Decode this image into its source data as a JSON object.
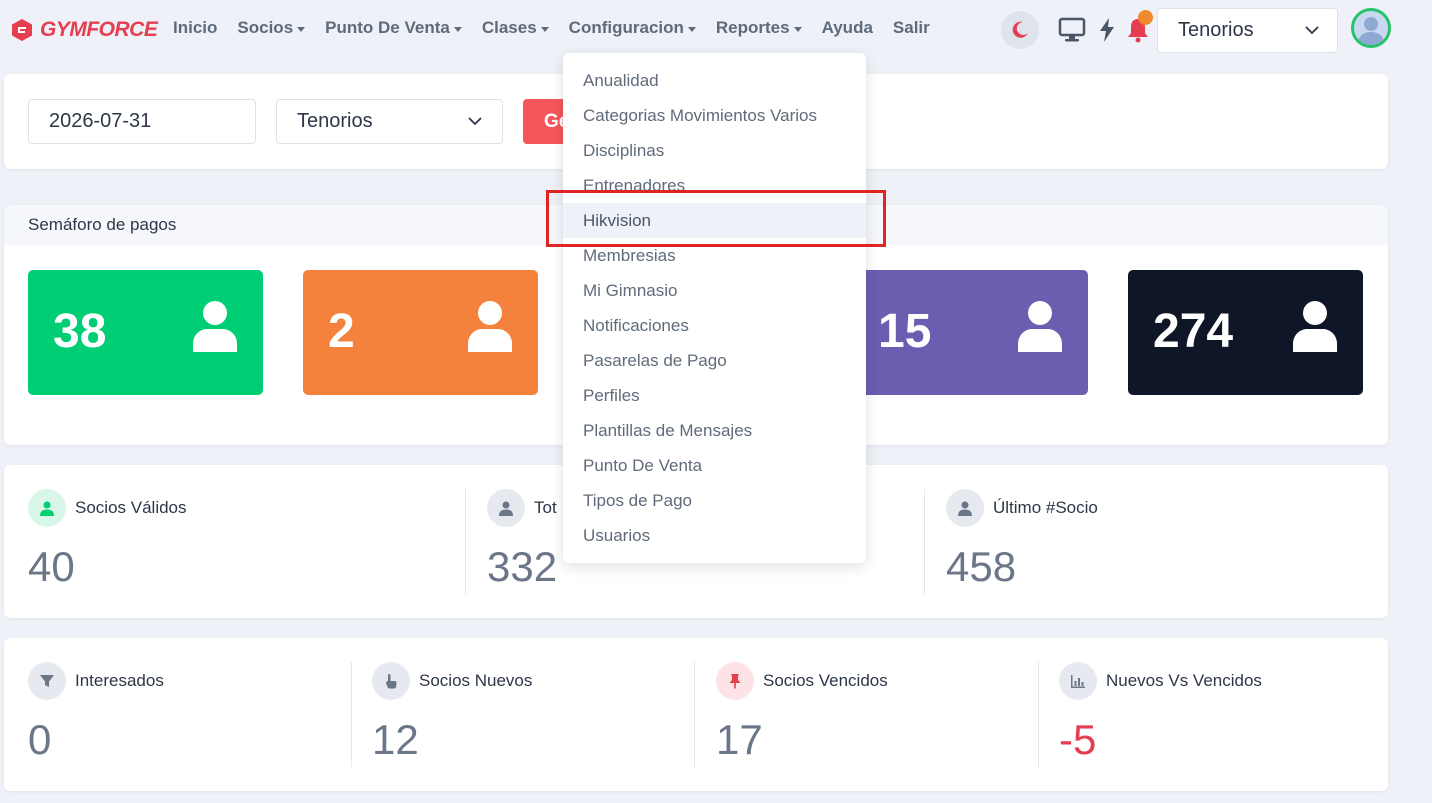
{
  "brand": {
    "name": "GYMFORCE"
  },
  "nav": {
    "items": [
      {
        "label": "Inicio",
        "caret": false
      },
      {
        "label": "Socios",
        "caret": true
      },
      {
        "label": "Punto De Venta",
        "caret": true
      },
      {
        "label": "Clases",
        "caret": true
      },
      {
        "label": "Configuracion",
        "caret": true
      },
      {
        "label": "Reportes",
        "caret": true
      },
      {
        "label": "Ayuda",
        "caret": false
      },
      {
        "label": "Salir",
        "caret": false
      }
    ],
    "gym_selected": "Tenorios"
  },
  "filters": {
    "date": "2026-07-31",
    "gym": "Tenorios",
    "generate_label": "Ge"
  },
  "semaforo": {
    "title": "Semáforo de pagos",
    "tiles": [
      {
        "value": "38",
        "color": "#00ce74"
      },
      {
        "value": "2",
        "color": "#f5823c"
      },
      {
        "value": "15",
        "color": "#6b5db0"
      },
      {
        "value": "274",
        "color": "#0e1628"
      }
    ]
  },
  "stats_row1": [
    {
      "label": "Socios Válidos",
      "value": "40"
    },
    {
      "label": "Tot",
      "value": "332"
    },
    {
      "label": "Último #Socio",
      "value": "458"
    }
  ],
  "stats_row2": [
    {
      "label": "Interesados",
      "value": "0"
    },
    {
      "label": "Socios Nuevos",
      "value": "12"
    },
    {
      "label": "Socios Vencidos",
      "value": "17"
    },
    {
      "label": "Nuevos Vs Vencidos",
      "value": "-5"
    }
  ],
  "config_menu": {
    "items": [
      "Anualidad",
      "Categorias Movimientos Varios",
      "Disciplinas",
      "Entrenadores",
      "Hikvision",
      "Membresias",
      "Mi Gimnasio",
      "Notificaciones",
      "Pasarelas de Pago",
      "Perfiles",
      "Plantillas de Mensajes",
      "Punto De Venta",
      "Tipos de Pago",
      "Usuarios"
    ],
    "active_index": 4
  }
}
